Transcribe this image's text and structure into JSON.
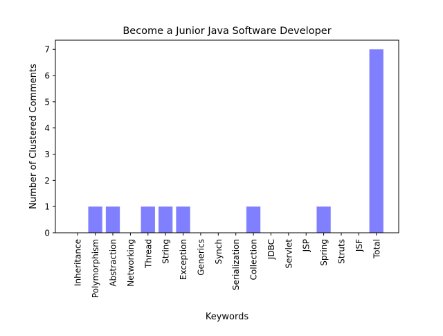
{
  "colors": {
    "bar": "#8080ff",
    "axis": "#000000",
    "background": "#ffffff"
  },
  "chart_data": {
    "type": "bar",
    "title": "Become a Junior Java Software Developer",
    "xlabel": "Keywords",
    "ylabel": "Number of Clustered Comments",
    "categories": [
      "Inheritance",
      "Polymorphism",
      "Abstraction",
      "Networking",
      "Thread",
      "String",
      "Exception",
      "Generics",
      "Synch",
      "Serialization",
      "Collection",
      "JDBC",
      "Servlet",
      "JSP",
      "Spring",
      "Struts",
      "JSF",
      "Total"
    ],
    "values": [
      0,
      1,
      1,
      0,
      1,
      1,
      1,
      0,
      0,
      0,
      1,
      0,
      0,
      0,
      1,
      0,
      0,
      7
    ],
    "yticks": [
      0,
      1,
      2,
      3,
      4,
      5,
      6,
      7
    ],
    "ylim": [
      0,
      7.35
    ],
    "grid": false,
    "legend": "none"
  }
}
